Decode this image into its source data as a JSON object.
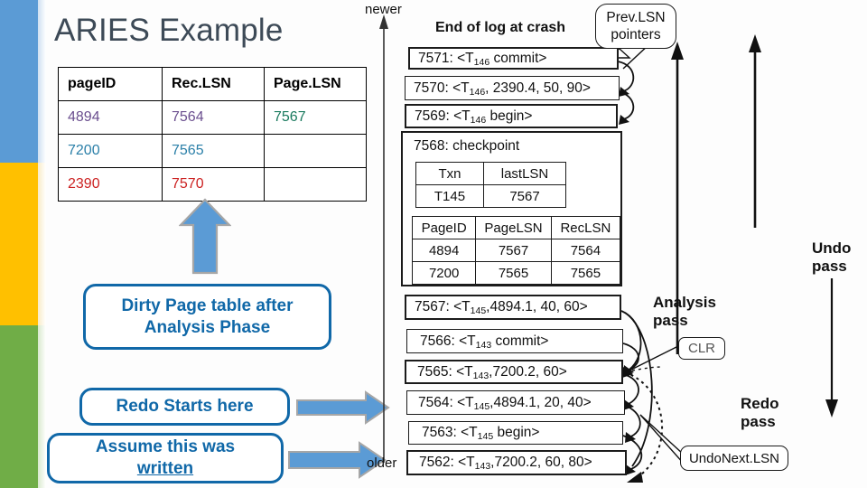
{
  "slide": {
    "title": "ARIES Example"
  },
  "sidebar": {
    "bars": [
      {
        "name": "blue",
        "color": "#5b9bd5"
      },
      {
        "name": "yellow",
        "color": "#ffc000"
      },
      {
        "name": "green",
        "color": "#70ad47"
      }
    ]
  },
  "dirty_page_table": {
    "headers": [
      "pageID",
      "Rec.LSN",
      "Page.LSN"
    ],
    "rows": [
      {
        "pageID": "4894",
        "recLSN": "7564",
        "pageLSN": "7567",
        "color": "#6b4f8f",
        "pageLSN_color": "#1a7a5e"
      },
      {
        "pageID": "7200",
        "recLSN": "7565",
        "pageLSN": "",
        "color": "#2a7fa8",
        "pageLSN_color": "#2a7fa8"
      },
      {
        "pageID": "2390",
        "recLSN": "7570",
        "pageLSN": "",
        "color": "#cc2222",
        "pageLSN_color": "#cc2222"
      }
    ]
  },
  "callouts": {
    "dirty_page_line1": "Dirty Page table after",
    "dirty_page_line2": "Analysis Phase",
    "redo_starts": "Redo Starts here",
    "assume_line1": "Assume this was",
    "assume_line2": "written"
  },
  "log": {
    "axis_top_label": "newer",
    "axis_bottom_label": "older",
    "end_of_log": "End of log at crash",
    "records": [
      {
        "lsn": "7571",
        "body": "<T",
        "sub": "146",
        "tail": " commit>"
      },
      {
        "lsn": "7570",
        "body": "<T",
        "sub": "146",
        "tail": ", 2390.4, 50, 90>"
      },
      {
        "lsn": "7569",
        "body": "<T",
        "sub": "146",
        "tail": " begin>"
      },
      {
        "lsn": "7567",
        "body": "<T",
        "sub": "145",
        "tail": ",4894.1, 40, 60>"
      },
      {
        "lsn": "7566",
        "body": "<T",
        "sub": "143",
        "tail": " commit>"
      },
      {
        "lsn": "7565",
        "body": "<T",
        "sub": "143",
        "tail": ",7200.2, 60>"
      },
      {
        "lsn": "7564",
        "body": "<T",
        "sub": "145",
        "tail": ",4894.1, 20, 40>"
      },
      {
        "lsn": "7563",
        "body": "<T",
        "sub": "145",
        "tail": " begin>"
      },
      {
        "lsn": "7562",
        "body": "<T",
        "sub": "143",
        "tail": ",7200.2, 60, 80>"
      }
    ],
    "checkpoint": {
      "title": "7568: checkpoint",
      "txn_table": {
        "headers": [
          "Txn",
          "lastLSN"
        ],
        "rows": [
          [
            "T145",
            "7567"
          ]
        ]
      },
      "page_table": {
        "headers": [
          "PageID",
          "PageLSN",
          "RecLSN"
        ],
        "rows": [
          [
            "4894",
            "7567",
            "7564"
          ],
          [
            "7200",
            "7565",
            "7565"
          ]
        ]
      }
    }
  },
  "annotations": {
    "prev_lsn_line1": "Prev.LSN",
    "prev_lsn_line2": "pointers",
    "analysis_line1": "Analysis",
    "analysis_line2": "pass",
    "redo_line1": "Redo",
    "redo_line2": "pass",
    "undo_line1": "Undo",
    "undo_line2": "pass",
    "clr": "CLR",
    "undo_next_lsn": "UndoNext.LSN"
  }
}
